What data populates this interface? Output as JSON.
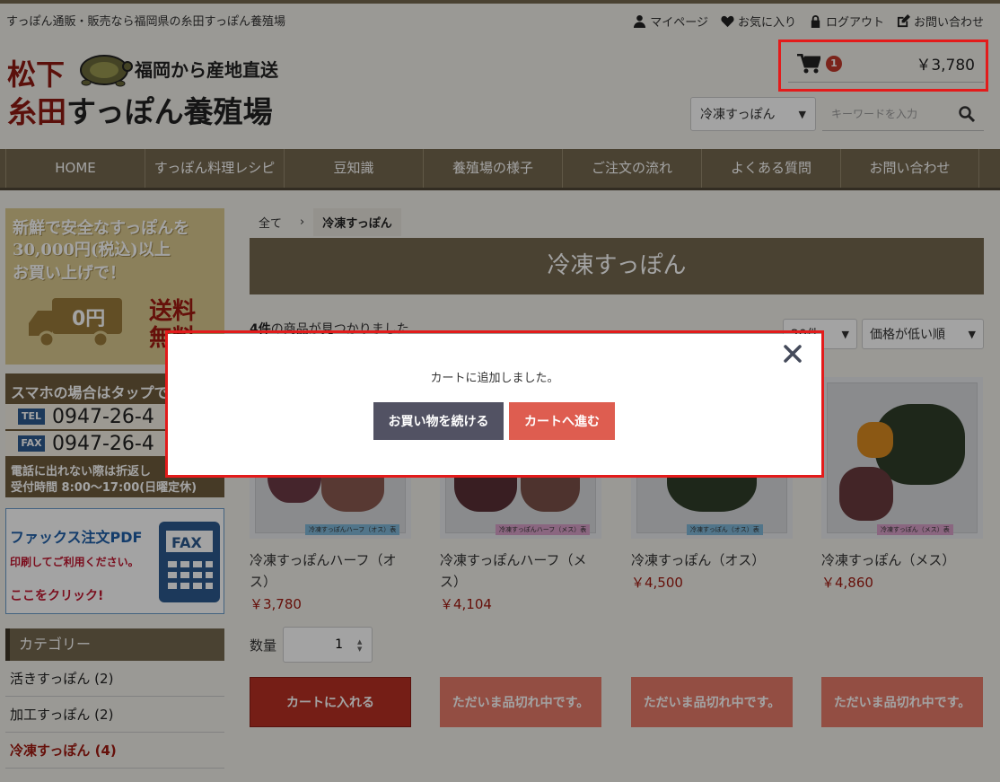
{
  "header": {
    "tagline": "すっぽん通販・販売なら福岡県の糸田すっぽん養殖場",
    "util_links": [
      {
        "label": "マイページ",
        "icon": "user-icon"
      },
      {
        "label": "お気に入り",
        "icon": "heart-icon"
      },
      {
        "label": "ログアウト",
        "icon": "lock-icon"
      },
      {
        "label": "お問い合わせ",
        "icon": "edit-icon"
      }
    ],
    "logo": {
      "line1": "松下",
      "catch": "福岡から産地直送",
      "line2_red": "糸田",
      "line2_rest": "すっぽん養殖場"
    },
    "cart": {
      "count": "1",
      "total": "￥3,780"
    },
    "category_select": "冷凍すっぽん",
    "search_placeholder": "キーワードを入力"
  },
  "global_nav": [
    "HOME",
    "すっぽん料理レシピ",
    "豆知識",
    "養殖場の様子",
    "ご注文の流れ",
    "よくある質問",
    "お問い合わせ"
  ],
  "sidebar": {
    "shipping_banner": {
      "line1": "新鮮で安全なすっぽんを",
      "line2": "30,000円(税込)以上",
      "line3": "お買い上げで！",
      "truck_text": "0円",
      "free_text": "送料無料"
    },
    "phone_banner": {
      "top": "スマホの場合はタップで電話",
      "tel_tag": "TEL",
      "tel": "0947-26-4",
      "fax_tag": "FAX",
      "fax": "0947-26-4",
      "note1": "電話に出れない際は折返し",
      "note2": "受付時間 8:00〜17:00(日曜定休)"
    },
    "fax_banner": {
      "title": "ファックス注文PDF",
      "sub": "印刷してご利用ください。",
      "click": "ここをクリック!",
      "fax_label": "FAX"
    },
    "category_heading": "カテゴリー",
    "categories": [
      {
        "label": "活きすっぽん (2)",
        "active": false
      },
      {
        "label": "加工すっぽん (2)",
        "active": false
      },
      {
        "label": "冷凍すっぽん (4)",
        "active": true
      }
    ]
  },
  "main": {
    "breadcrumb": [
      "全て",
      "冷凍すっぽん"
    ],
    "title": "冷凍すっぽん",
    "result_count_num": "4件",
    "result_count_text": "の商品が見つかりました",
    "per_page_select": "20件",
    "sort_select": "価格が低い順",
    "products": [
      {
        "name": "冷凍すっぽんハーフ（オス）",
        "price": "￥3,780",
        "label": "冷凍すっぽんハーフ（オス）表",
        "label_color": "#7fb8d8"
      },
      {
        "name": "冷凍すっぽんハーフ（メス）",
        "price": "￥4,104",
        "label": "冷凍すっぽんハーフ（メス）表",
        "label_color": "#d8a0c8"
      },
      {
        "name": "冷凍すっぽん（オス）",
        "price": "￥4,500",
        "label": "冷凍すっぽん（オス）表",
        "label_color": "#7fb8d8"
      },
      {
        "name": "冷凍すっぽん（メス）",
        "price": "￥4,860",
        "label": "冷凍すっぽん（メス）表",
        "label_color": "#d8a0c8"
      }
    ],
    "qty_label": "数量",
    "qty_value": "1",
    "add_to_cart": "カートに入れる",
    "sold_out": "ただいま品切れ中です。"
  },
  "modal": {
    "message": "カートに追加しました。",
    "continue_label": "お買い物を続ける",
    "checkout_label": "カートへ進む",
    "close_icon": "close-icon"
  }
}
